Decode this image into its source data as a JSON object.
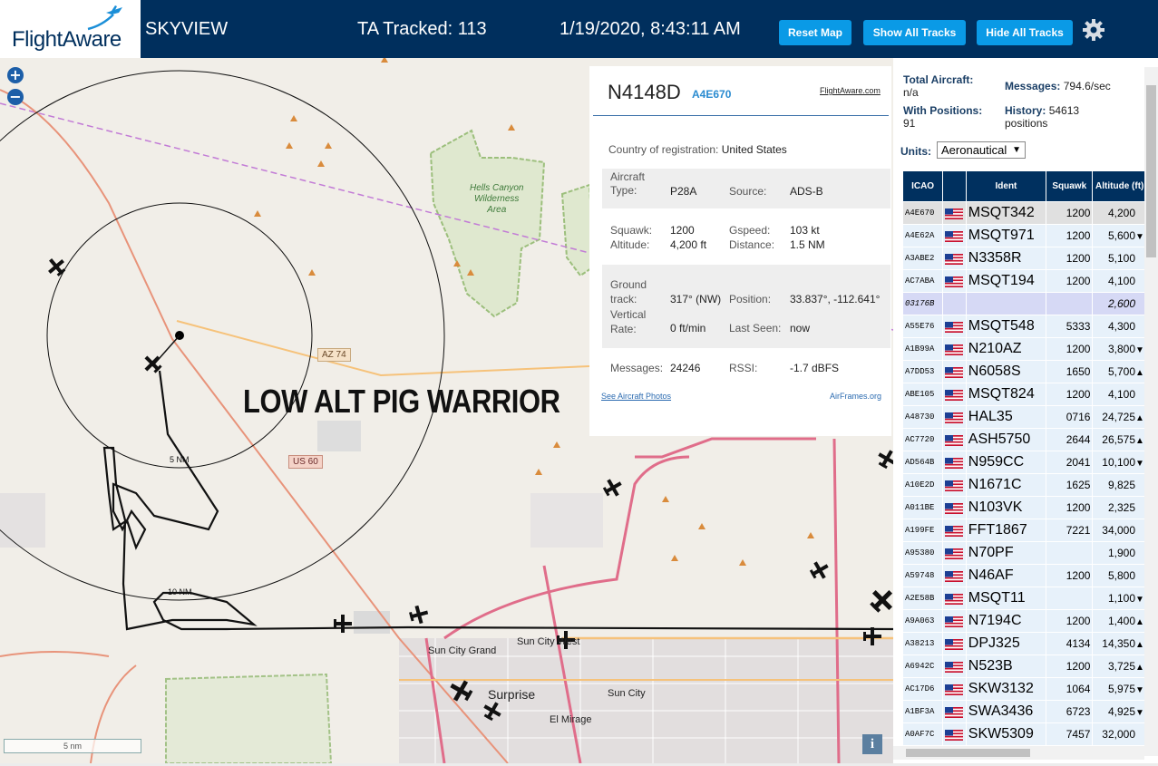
{
  "header": {
    "logo_text": "FlightAware",
    "app_title": "SKYVIEW",
    "tracked": "TA Tracked: 113",
    "datetime": "1/19/2020, 8:43:11 AM",
    "buttons": {
      "reset": "Reset Map",
      "show_all": "Show All Tracks",
      "hide_all": "Hide All Tracks"
    }
  },
  "map": {
    "zoom_in": "+",
    "zoom_out": "−",
    "overlay_label": "LOW ALT PIG WARRIOR",
    "scale_label": "5 nm",
    "info": "i",
    "labels": {
      "wilderness": [
        "Hells Canyon",
        "Wilderness",
        "Area"
      ],
      "az74": "AZ 74",
      "us60": "US 60",
      "ring5": "5 NM",
      "ring10": "10 NM",
      "sun_city_grand": "Sun City Grand",
      "sun_city_west": "Sun City West",
      "surprise": "Surprise",
      "sun_city": "Sun City",
      "el_mirage": "El Mirage"
    }
  },
  "popup": {
    "registration": "N4148D",
    "icao": "A4E670",
    "fa_link": "FlightAware.com",
    "country_label": "Country of registration:",
    "country": "United States",
    "aircraft_type_label": "Aircraft Type:",
    "aircraft_type": "P28A",
    "source_label": "Source:",
    "source": "ADS-B",
    "squawk_label": "Squawk:",
    "squawk": "1200",
    "gspeed_label": "Gspeed:",
    "gspeed": "103 kt",
    "altitude_label": "Altitude:",
    "altitude": "4,200 ft",
    "distance_label": "Distance:",
    "distance": "1.5 NM",
    "ground_track_label": "Ground track:",
    "ground_track": "317° (NW)",
    "position_label": "Position:",
    "position": "33.837°, -112.641°",
    "vertical_rate_label": "Vertical Rate:",
    "vertical_rate": "0 ft/min",
    "last_seen_label": "Last Seen:",
    "last_seen": "now",
    "messages_label": "Messages:",
    "messages": "24246",
    "rssi_label": "RSSI:",
    "rssi": "-1.7 dBFS",
    "photos_link": "See Aircraft Photos",
    "airframes_link": "AirFrames.org"
  },
  "sidebar": {
    "total_label": "Total Aircraft:",
    "total": "n/a",
    "messages_label": "Messages:",
    "messages": "794.6/sec",
    "positions_label": "With Positions:",
    "positions": "91",
    "history_label": "History:",
    "history": "54613 positions",
    "units_label": "Units:",
    "units_value": "Aeronautical",
    "columns": [
      "ICAO",
      "",
      "Ident",
      "Squawk",
      "Altitude (ft)"
    ],
    "rows": [
      {
        "icao": "A4E670",
        "ident": "MSQT342",
        "squawk": "1200",
        "alt": "4,200",
        "trend": "",
        "state": "sel"
      },
      {
        "icao": "A4E62A",
        "ident": "MSQT971",
        "squawk": "1200",
        "alt": "5,600",
        "trend": "▼",
        "state": ""
      },
      {
        "icao": "A3ABE2",
        "ident": "N3358R",
        "squawk": "1200",
        "alt": "5,100",
        "trend": "",
        "state": ""
      },
      {
        "icao": "AC7ABA",
        "ident": "MSQT194",
        "squawk": "1200",
        "alt": "4,100",
        "trend": "",
        "state": ""
      },
      {
        "icao": "03176B",
        "ident": "",
        "squawk": "",
        "alt": "2,600",
        "trend": "",
        "state": "hl"
      },
      {
        "icao": "A55E76",
        "ident": "MSQT548",
        "squawk": "5333",
        "alt": "4,300",
        "trend": "",
        "state": ""
      },
      {
        "icao": "A1B99A",
        "ident": "N210AZ",
        "squawk": "1200",
        "alt": "3,800",
        "trend": "▼",
        "state": ""
      },
      {
        "icao": "A7DD53",
        "ident": "N6058S",
        "squawk": "1650",
        "alt": "5,700",
        "trend": "▲",
        "state": ""
      },
      {
        "icao": "ABE105",
        "ident": "MSQT824",
        "squawk": "1200",
        "alt": "4,100",
        "trend": "",
        "state": ""
      },
      {
        "icao": "A48730",
        "ident": "HAL35",
        "squawk": "0716",
        "alt": "24,725",
        "trend": "▲",
        "state": ""
      },
      {
        "icao": "AC7720",
        "ident": "ASH5750",
        "squawk": "2644",
        "alt": "26,575",
        "trend": "▲",
        "state": ""
      },
      {
        "icao": "AD564B",
        "ident": "N959CC",
        "squawk": "2041",
        "alt": "10,100",
        "trend": "▼",
        "state": ""
      },
      {
        "icao": "A10E2D",
        "ident": "N1671C",
        "squawk": "1625",
        "alt": "9,825",
        "trend": "",
        "state": ""
      },
      {
        "icao": "A011BE",
        "ident": "N103VK",
        "squawk": "1200",
        "alt": "2,325",
        "trend": "",
        "state": ""
      },
      {
        "icao": "A199FE",
        "ident": "FFT1867",
        "squawk": "7221",
        "alt": "34,000",
        "trend": "",
        "state": ""
      },
      {
        "icao": "A95380",
        "ident": "N70PF",
        "squawk": "",
        "alt": "1,900",
        "trend": "",
        "state": ""
      },
      {
        "icao": "A59748",
        "ident": "N46AF",
        "squawk": "1200",
        "alt": "5,800",
        "trend": "",
        "state": ""
      },
      {
        "icao": "A2E58B",
        "ident": "MSQT11",
        "squawk": "",
        "alt": "1,100",
        "trend": "▼",
        "state": ""
      },
      {
        "icao": "A9A063",
        "ident": "N7194C",
        "squawk": "1200",
        "alt": "1,400",
        "trend": "▲",
        "state": ""
      },
      {
        "icao": "A38213",
        "ident": "DPJ325",
        "squawk": "4134",
        "alt": "14,350",
        "trend": "▲",
        "state": ""
      },
      {
        "icao": "A6942C",
        "ident": "N523B",
        "squawk": "1200",
        "alt": "3,725",
        "trend": "▲",
        "state": ""
      },
      {
        "icao": "AC17D6",
        "ident": "SKW3132",
        "squawk": "1064",
        "alt": "5,975",
        "trend": "▼",
        "state": ""
      },
      {
        "icao": "A1BF3A",
        "ident": "SWA3436",
        "squawk": "6723",
        "alt": "4,925",
        "trend": "▼",
        "state": ""
      },
      {
        "icao": "A0AF7C",
        "ident": "SKW5309",
        "squawk": "7457",
        "alt": "32,000",
        "trend": "",
        "state": ""
      }
    ]
  },
  "colors": {
    "header_bg": "#002f5d",
    "button_bg": "#0a9ae6",
    "table_header": "#00305f",
    "row_bg": "#e7f1fa"
  }
}
